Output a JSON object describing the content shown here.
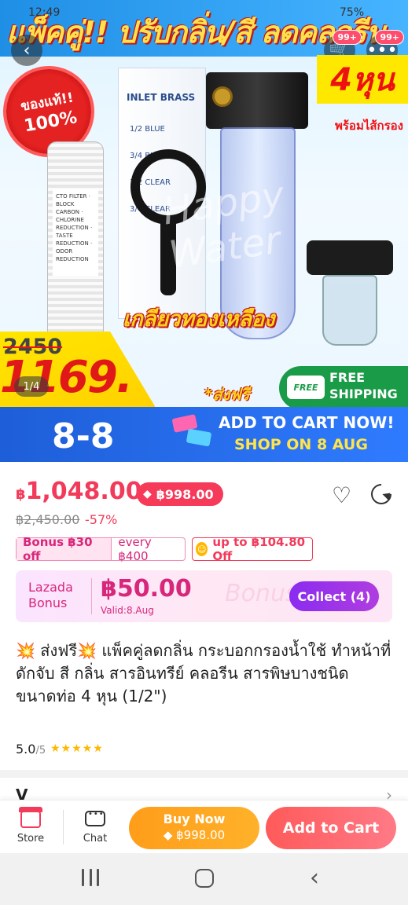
{
  "status_bar": {
    "time": "12:49",
    "battery": "75%"
  },
  "hero": {
    "banner_title": "แพ็คคู่!! ปรับกลิ่น/สี ลดคลอรีน",
    "genuine_badge": {
      "line1": "ของแท้!!",
      "line2": "100%"
    },
    "size_tag": "4หุน",
    "with_filter": "พร้อมไส้กรอง",
    "box_title": "INLET BRASS",
    "box_rows": [
      "1/2   BLUE",
      "3/4   BLUE",
      "1/2   CLEAR",
      "3/4   CLEAR"
    ],
    "cartridge_label": "CTO FILTER · BLOCK CARBON · CHLORINE REDUCTION · TASTE REDUCTION · ODOR REDUCTION",
    "brass_text": "เกลียวทองเหลือง",
    "watermark": "Happy Water",
    "old_price": "2450",
    "price": "1169.",
    "image_counter": "1/4",
    "free_ship_th": "*ส่งฟรี",
    "free_ship_icon": "FREE",
    "free_ship_line1": "FREE",
    "free_ship_line2": "SHIPPING",
    "promo_88": "8-8",
    "promo_line1": "ADD TO CART NOW!",
    "promo_line2": "SHOP ON 8 AUG",
    "cart_badge": "99+",
    "more_badge": "99+"
  },
  "product": {
    "currency_symbol": "฿",
    "price": "1,048.00",
    "voucher_price": "฿998.00",
    "old_price": "฿2,450.00",
    "discount": "-57%",
    "chip_bonus": "Bonus ฿30 off",
    "chip_every": "every ฿400",
    "chip_up_to": "up to ฿104.80 Off",
    "bonus_brand_line1": "Lazada",
    "bonus_brand_line2": "Bonus",
    "bonus_amount": "฿50.00",
    "bonus_valid": "Valid:8.Aug",
    "collect_label": "Collect (4)",
    "title": "💥 ส่งฟรี💥 แพ็คคู่ลดกลิ่น กระบอกกรองน้ำใช้ ทำหน้าที่ดักจับ สี กลิ่น สารอินทรีย์ คลอรีน สารพิษบางชนิด ขนาดท่อ 4 หุน (1/2\")",
    "rating_value": "5.0",
    "rating_scale": "/5",
    "stars": "★★★★★",
    "next_section": "V"
  },
  "action_bar": {
    "store_label": "Store",
    "chat_label": "Chat",
    "buy_now_label": "Buy Now",
    "buy_now_price": "฿998.00",
    "add_to_cart_label": "Add to Cart"
  },
  "colors": {
    "price_red": "#f23a5a",
    "bonus_pink": "#d8267a",
    "collect_purple": "#8a2cf0",
    "buy_now_orange": "#ffa11f",
    "add_cart_coral": "#ff6470"
  }
}
